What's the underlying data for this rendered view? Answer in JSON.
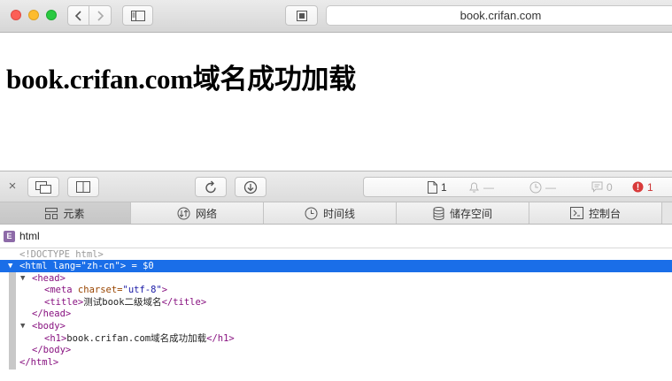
{
  "browser": {
    "url": "book.crifan.com",
    "controls": {
      "back_icon": "chevron-left-icon",
      "forward_icon": "chevron-right-icon",
      "sidebar_icon": "sidebar-icon",
      "reader_icon": "reader-icon"
    }
  },
  "page": {
    "heading": "book.crifan.com域名成功加载"
  },
  "inspector": {
    "toolbar": {
      "close_icon": "×",
      "status": {
        "resources_count": "1",
        "warnings_count": "—",
        "time": "—",
        "logs_count": "0",
        "errors_count": "1"
      }
    },
    "tabs": [
      {
        "label": "元素",
        "icon": "elements-icon",
        "active": true
      },
      {
        "label": "网络",
        "icon": "network-icon",
        "active": false
      },
      {
        "label": "时间线",
        "icon": "timeline-icon",
        "active": false
      },
      {
        "label": "储存空间",
        "icon": "storage-icon",
        "active": false
      },
      {
        "label": "控制台",
        "icon": "console-icon",
        "active": false
      }
    ],
    "breadcrumb": {
      "icon_letter": "E",
      "label": "html"
    },
    "dom_tree": {
      "doctype": "<!DOCTYPE html>",
      "html_open_tag": "<html",
      "html_attr_name": " lang=",
      "html_attr_value": "\"zh-cn\"",
      "html_open_end": ">",
      "selected_suffix": " = $0",
      "head_open": "<head>",
      "meta_tag": "<meta",
      "meta_attr_name": " charset=",
      "meta_attr_value": "\"utf-8\"",
      "meta_end": ">",
      "title_open": "<title>",
      "title_text": "测试book二级域名",
      "title_close": "</title>",
      "head_close": "</head>",
      "body_open": "<body>",
      "h1_open": "<h1>",
      "h1_text": "book.crifan.com域名成功加载",
      "h1_close": "</h1>",
      "body_close": "</body>",
      "html_close": "</html>"
    }
  },
  "colors": {
    "selection": "#1a6ee8",
    "tag": "#881280",
    "attr_name": "#994500",
    "attr_value": "#1a1aa6",
    "error": "#cc3333"
  }
}
